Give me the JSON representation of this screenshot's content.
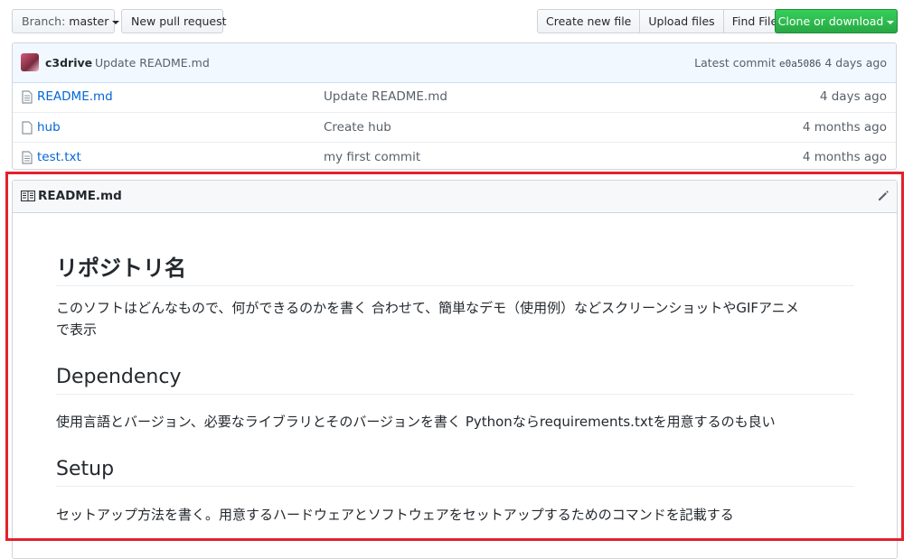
{
  "toolbar": {
    "branch_label": "Branch:",
    "branch_name": "master",
    "new_pull_request": "New pull request",
    "create_new_file": "Create new file",
    "upload_files": "Upload files",
    "find_file": "Find File",
    "clone_or_download": "Clone or download"
  },
  "commit": {
    "author": "c3drive",
    "message": "Update README.md",
    "latest_label": "Latest commit",
    "sha": "e0a5086",
    "age": "4 days ago"
  },
  "files": [
    {
      "name": "README.md",
      "message": "Update README.md",
      "age": "4 days ago",
      "icon": "file-icon"
    },
    {
      "name": "hub",
      "message": "Create hub",
      "age": "4 months ago",
      "icon": "file-icon"
    },
    {
      "name": "test.txt",
      "message": "my first commit",
      "age": "4 months ago",
      "icon": "file-icon"
    }
  ],
  "readme": {
    "title": "README.md",
    "icon": "book-icon",
    "edit_icon": "pencil-icon",
    "h1": "リポジトリ名",
    "p1_line1": "このソフトはどんなもので、何ができるのかを書く 合わせて、簡単なデモ（使用例）などスクリーンショットやGIFアニメ",
    "p1_line2": "で表示",
    "h2_dependency": "Dependency",
    "p2": "使用言語とバージョン、必要なライブラリとそのバージョンを書く Pythonならrequirements.txtを用意するのも良い",
    "h2_setup": "Setup",
    "p3": "セットアップ方法を書く。用意するハードウェアとソフトウェアをセットアップするためのコマンドを記載する"
  },
  "colors": {
    "highlight_border": "#e3212b",
    "clone_button": "#28a745",
    "link": "#0366d6"
  }
}
